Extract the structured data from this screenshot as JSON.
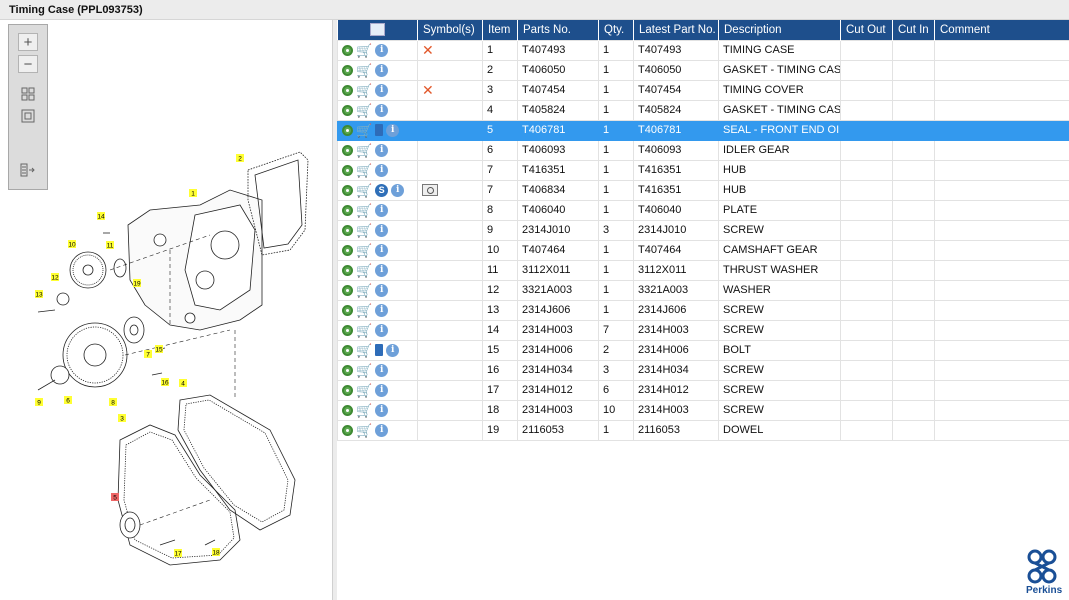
{
  "window": {
    "title": "Timing Case (PPL093753)"
  },
  "toolbar": {
    "icons": [
      "zoom-in-icon",
      "zoom-out-icon",
      "fit-view-icon",
      "actual-size-icon",
      "export-list-icon"
    ]
  },
  "grid": {
    "headers": [
      "",
      "Symbol(s)",
      "Item",
      "Parts No.",
      "Qty.",
      "Latest Part No.",
      "Description",
      "Cut Out",
      "Cut In",
      "Comment"
    ],
    "rows": [
      {
        "item": "1",
        "part": "T407493",
        "qty": "1",
        "latest": "T407493",
        "desc": "TIMING CASE",
        "symbol": "x",
        "sel": false,
        "extra": ""
      },
      {
        "item": "2",
        "part": "T406050",
        "qty": "1",
        "latest": "T406050",
        "desc": "GASKET - TIMING CASE",
        "symbol": "",
        "sel": false,
        "extra": ""
      },
      {
        "item": "3",
        "part": "T407454",
        "qty": "1",
        "latest": "T407454",
        "desc": "TIMING COVER",
        "symbol": "x",
        "sel": false,
        "extra": ""
      },
      {
        "item": "4",
        "part": "T405824",
        "qty": "1",
        "latest": "T405824",
        "desc": "GASKET - TIMING CASE C",
        "symbol": "",
        "sel": false,
        "extra": ""
      },
      {
        "item": "5",
        "part": "T406781",
        "qty": "1",
        "latest": "T406781",
        "desc": "SEAL - FRONT END OIL",
        "symbol": "",
        "sel": true,
        "extra": "book"
      },
      {
        "item": "6",
        "part": "T406093",
        "qty": "1",
        "latest": "T406093",
        "desc": "IDLER GEAR",
        "symbol": "",
        "sel": false,
        "extra": ""
      },
      {
        "item": "7",
        "part": "T416351",
        "qty": "1",
        "latest": "T416351",
        "desc": "HUB",
        "symbol": "",
        "sel": false,
        "extra": ""
      },
      {
        "item": "7",
        "part": "T406834",
        "qty": "1",
        "latest": "T416351",
        "desc": "HUB",
        "symbol": "zoom",
        "sel": false,
        "extra": "s"
      },
      {
        "item": "8",
        "part": "T406040",
        "qty": "1",
        "latest": "T406040",
        "desc": "PLATE",
        "symbol": "",
        "sel": false,
        "extra": ""
      },
      {
        "item": "9",
        "part": "2314J010",
        "qty": "3",
        "latest": "2314J010",
        "desc": "SCREW",
        "symbol": "",
        "sel": false,
        "extra": ""
      },
      {
        "item": "10",
        "part": "T407464",
        "qty": "1",
        "latest": "T407464",
        "desc": "CAMSHAFT GEAR",
        "symbol": "",
        "sel": false,
        "extra": ""
      },
      {
        "item": "11",
        "part": "3112X011",
        "qty": "1",
        "latest": "3112X011",
        "desc": "THRUST WASHER",
        "symbol": "",
        "sel": false,
        "extra": ""
      },
      {
        "item": "12",
        "part": "3321A003",
        "qty": "1",
        "latest": "3321A003",
        "desc": "WASHER",
        "symbol": "",
        "sel": false,
        "extra": ""
      },
      {
        "item": "13",
        "part": "2314J606",
        "qty": "1",
        "latest": "2314J606",
        "desc": "SCREW",
        "symbol": "",
        "sel": false,
        "extra": ""
      },
      {
        "item": "14",
        "part": "2314H003",
        "qty": "7",
        "latest": "2314H003",
        "desc": "SCREW",
        "symbol": "",
        "sel": false,
        "extra": ""
      },
      {
        "item": "15",
        "part": "2314H006",
        "qty": "2",
        "latest": "2314H006",
        "desc": "BOLT",
        "symbol": "",
        "sel": false,
        "extra": "book"
      },
      {
        "item": "16",
        "part": "2314H034",
        "qty": "3",
        "latest": "2314H034",
        "desc": "SCREW",
        "symbol": "",
        "sel": false,
        "extra": ""
      },
      {
        "item": "17",
        "part": "2314H012",
        "qty": "6",
        "latest": "2314H012",
        "desc": "SCREW",
        "symbol": "",
        "sel": false,
        "extra": ""
      },
      {
        "item": "18",
        "part": "2314H003",
        "qty": "10",
        "latest": "2314H003",
        "desc": "SCREW",
        "symbol": "",
        "sel": false,
        "extra": ""
      },
      {
        "item": "19",
        "part": "2116053",
        "qty": "1",
        "latest": "2116053",
        "desc": "DOWEL",
        "symbol": "",
        "sel": false,
        "extra": ""
      }
    ]
  },
  "diagram": {
    "callouts": [
      "1",
      "2",
      "3",
      "4",
      "5",
      "6",
      "7",
      "8",
      "9",
      "10",
      "11",
      "12",
      "13",
      "14",
      "15",
      "16",
      "17",
      "18",
      "19"
    ]
  },
  "logo": {
    "text": "Perkins"
  },
  "colors": {
    "header": "#1e4f8c",
    "selection": "#3399ee",
    "callout": "#ffff33",
    "callout_selected": "#ee6666"
  }
}
